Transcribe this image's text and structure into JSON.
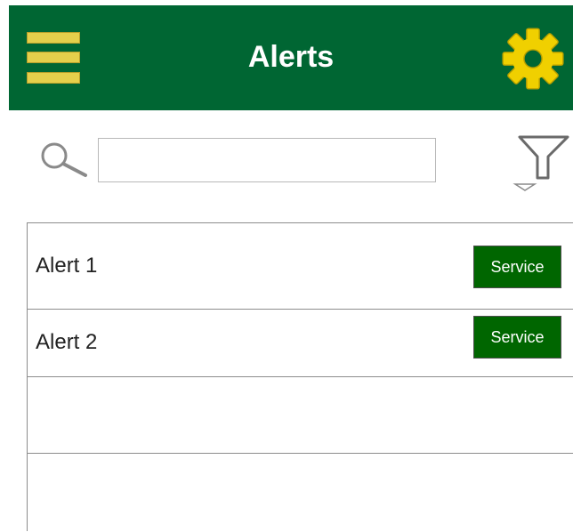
{
  "header": {
    "title": "Alerts",
    "menu_icon": "hamburger-menu-icon",
    "settings_icon": "gear-icon",
    "background_color": "#006633",
    "accent_color": "#e5cf4b"
  },
  "search": {
    "icon": "search-icon",
    "value": "",
    "placeholder": ""
  },
  "filter": {
    "icon": "filter-icon"
  },
  "alerts": [
    {
      "label": "Alert 1",
      "action_label": "Service"
    },
    {
      "label": "Alert 2",
      "action_label": "Service"
    },
    {
      "label": "",
      "action_label": ""
    },
    {
      "label": "",
      "action_label": ""
    }
  ],
  "colors": {
    "button_background": "#006600"
  }
}
